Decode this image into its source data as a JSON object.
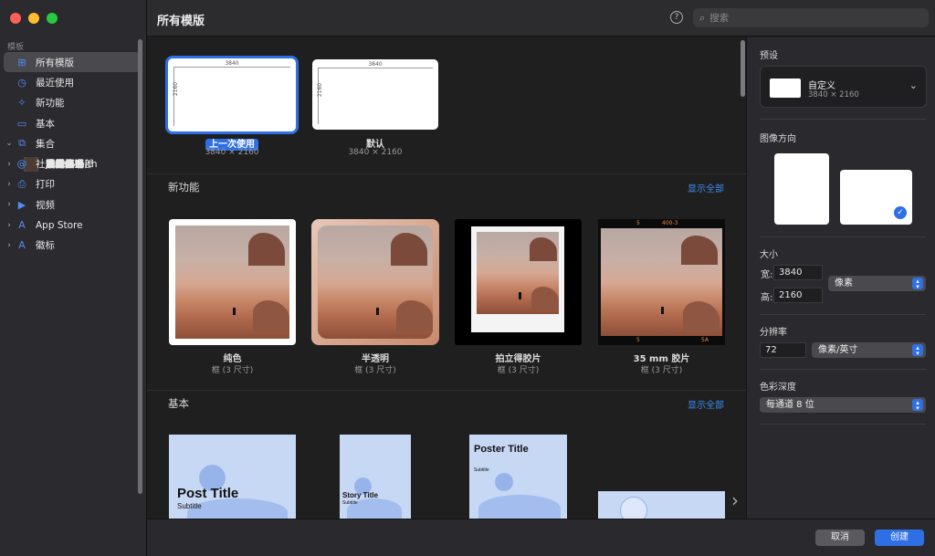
{
  "sidebar": {
    "section_label": "模板",
    "items": [
      {
        "label": "所有模版",
        "icon": "grid-icon",
        "active": true
      },
      {
        "label": "最近使用",
        "icon": "clock-icon"
      },
      {
        "label": "新功能",
        "icon": "sparkle-icon"
      },
      {
        "label": "基本",
        "icon": "square-icon"
      },
      {
        "label": "集合",
        "icon": "collections-icon",
        "expanded": true
      },
      {
        "label": "假期",
        "sub": true,
        "color": "#c9534a"
      },
      {
        "label": "美味传说",
        "sub": true,
        "color": "#4a8fd4"
      },
      {
        "label": "读书会",
        "sub": true,
        "color": "#5b7fc4"
      },
      {
        "label": "白松木",
        "sub": true,
        "color": "#b09370"
      },
      {
        "label": "设计展会",
        "sub": true,
        "color": "#e0a33a"
      },
      {
        "label": "Jane Smith",
        "sub": true,
        "color": "#2e7d4f"
      },
      {
        "label": "中提琴",
        "sub": true,
        "color": "#3f5fb5"
      },
      {
        "label": "瑜伽",
        "sub": true,
        "color": "#e4c9a7"
      },
      {
        "label": "爱我",
        "sub": true,
        "color": "#3a78d9"
      },
      {
        "label": "生命之海",
        "sub": true,
        "color": "#2b6f9a"
      },
      {
        "label": "泛光",
        "sub": true,
        "color": "#e8b94a"
      },
      {
        "label": "超越灵感",
        "sub": true,
        "color": "#d7703f"
      },
      {
        "label": "早餐俱乐部",
        "sub": true,
        "color": "#c2ab52"
      },
      {
        "label": "Nula",
        "sub": true,
        "color": "#c8a98c"
      },
      {
        "label": "清晰视野",
        "sub": true,
        "color": "#4b3b34"
      },
      {
        "label": "社交媒体",
        "icon": "at-icon",
        "collapsed": true
      },
      {
        "label": "打印",
        "icon": "print-icon",
        "collapsed": true
      },
      {
        "label": "视频",
        "icon": "video-icon",
        "collapsed": true
      },
      {
        "label": "App Store",
        "icon": "appstore-icon",
        "collapsed": true
      },
      {
        "label": "徽标",
        "icon": "logo-icon",
        "collapsed": true
      }
    ]
  },
  "topbar": {
    "title": "所有模版",
    "help": "?",
    "search_placeholder": "搜索"
  },
  "recent": [
    {
      "badge": "上一次使用",
      "size": "3840 × 2160",
      "w": "3840",
      "h": "2160",
      "selected": true
    },
    {
      "label": "默认",
      "size": "3840 × 2160",
      "w": "3840",
      "h": "2160"
    }
  ],
  "sections": {
    "new_features": {
      "title": "新功能",
      "show_all": "显示全部",
      "items": [
        {
          "label": "纯色",
          "sub": "框 (3 尺寸)"
        },
        {
          "label": "半透明",
          "sub": "框 (3 尺寸)"
        },
        {
          "label": "拍立得胶片",
          "sub": "框 (3 尺寸)"
        },
        {
          "label": "35 mm 胶片",
          "sub": "框 (3 尺寸)"
        }
      ],
      "film_marks": {
        "top_left": "5",
        "top_mid": "400-3",
        "bottom_left": "5",
        "bottom_right": "5A"
      }
    },
    "basic": {
      "title": "基本",
      "show_all": "显示全部",
      "items": [
        {
          "title": "Post Title",
          "subtitle": "Subtitle"
        },
        {
          "title": "Story Title",
          "subtitle": "Subtitle"
        },
        {
          "title": "Poster Title",
          "subtitle": "Subtitle"
        }
      ]
    }
  },
  "right_panel": {
    "preset_label": "预设",
    "preset_name": "自定义",
    "preset_size": "3840 × 2160",
    "orientation_label": "图像方向",
    "size_label": "大小",
    "width_label": "宽:",
    "width_value": "3840",
    "height_label": "高:",
    "height_value": "2160",
    "unit": "像素",
    "resolution_label": "分辨率",
    "resolution_value": "72",
    "resolution_unit": "像素/英寸",
    "color_depth_label": "色彩深度",
    "color_depth_value": "每通道 8 位"
  },
  "footer": {
    "cancel": "取消",
    "create": "创建"
  },
  "colors": {
    "accent": "#2f6fe4",
    "link": "#3b8cf5"
  }
}
